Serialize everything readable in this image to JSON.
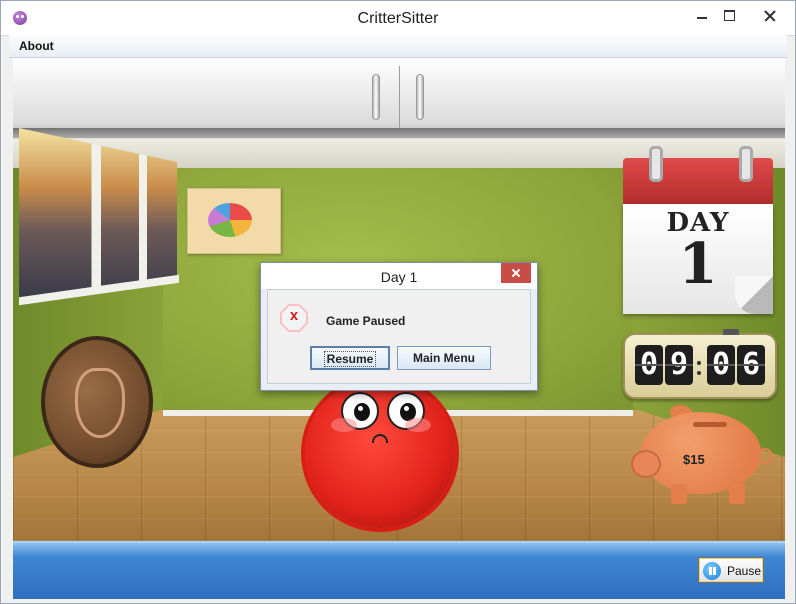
{
  "window": {
    "title": "CritterSitter"
  },
  "menu": {
    "items": [
      {
        "label": "About"
      }
    ]
  },
  "scene": {
    "calendar": {
      "label": "DAY",
      "day": "1"
    },
    "clock": {
      "digits": [
        "0",
        "9",
        "0",
        "6"
      ]
    },
    "piggy_bank": {
      "amount": "$15"
    }
  },
  "dialog": {
    "title": "Day 1",
    "message": "Game Paused",
    "icon": "error-icon",
    "buttons": {
      "resume": "Resume",
      "main_menu": "Main Menu"
    }
  },
  "bottom_bar": {
    "pause_label": "Pause"
  }
}
